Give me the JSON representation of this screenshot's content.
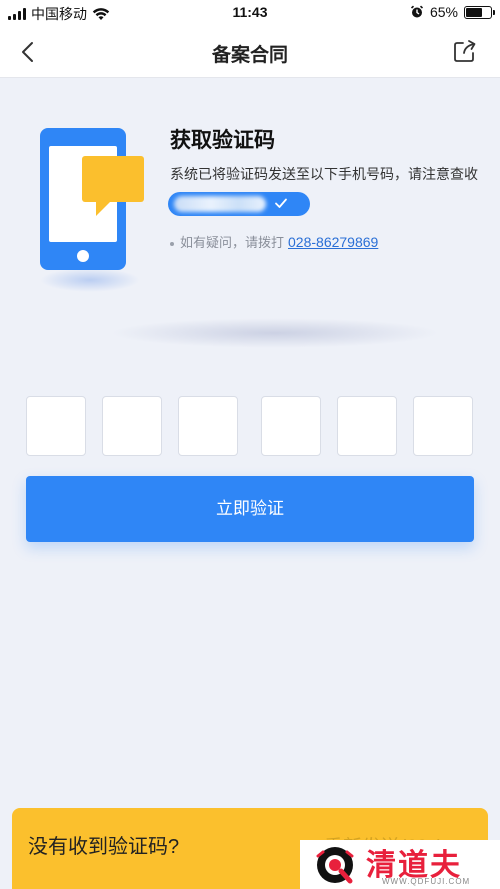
{
  "status_bar": {
    "carrier": "中国移动",
    "time": "11:43",
    "battery_text": "65%",
    "battery_level": 0.65,
    "icons": [
      "signal-icon",
      "wifi-icon",
      "alarm-icon",
      "battery-icon"
    ]
  },
  "nav": {
    "title": "备案合同",
    "back_icon": "chevron-left-icon",
    "share_icon": "share-icon"
  },
  "verify_info": {
    "title": "获取验证码",
    "description": "系统已将验证码发送至以下手机号码，请注意查收",
    "phone_masked": "",
    "help_prefix": "如有疑问，请拨打",
    "help_phone": "028-86279869"
  },
  "code_inputs": [
    "",
    "",
    "",
    "",
    "",
    ""
  ],
  "buttons": {
    "verify_label": "立即验证"
  },
  "bottom_banner": {
    "text": "没有收到验证码?",
    "resend_label": "重新发送(60s)"
  },
  "watermark": {
    "title": "清道夫",
    "url": "WWW.QDFUJI.COM"
  },
  "colors": {
    "primary": "#2f86f6",
    "background": "#eef1f8",
    "banner": "#fbc02d",
    "illustration_accent": "#fbbf2d",
    "watermark_red": "#e8203c"
  }
}
